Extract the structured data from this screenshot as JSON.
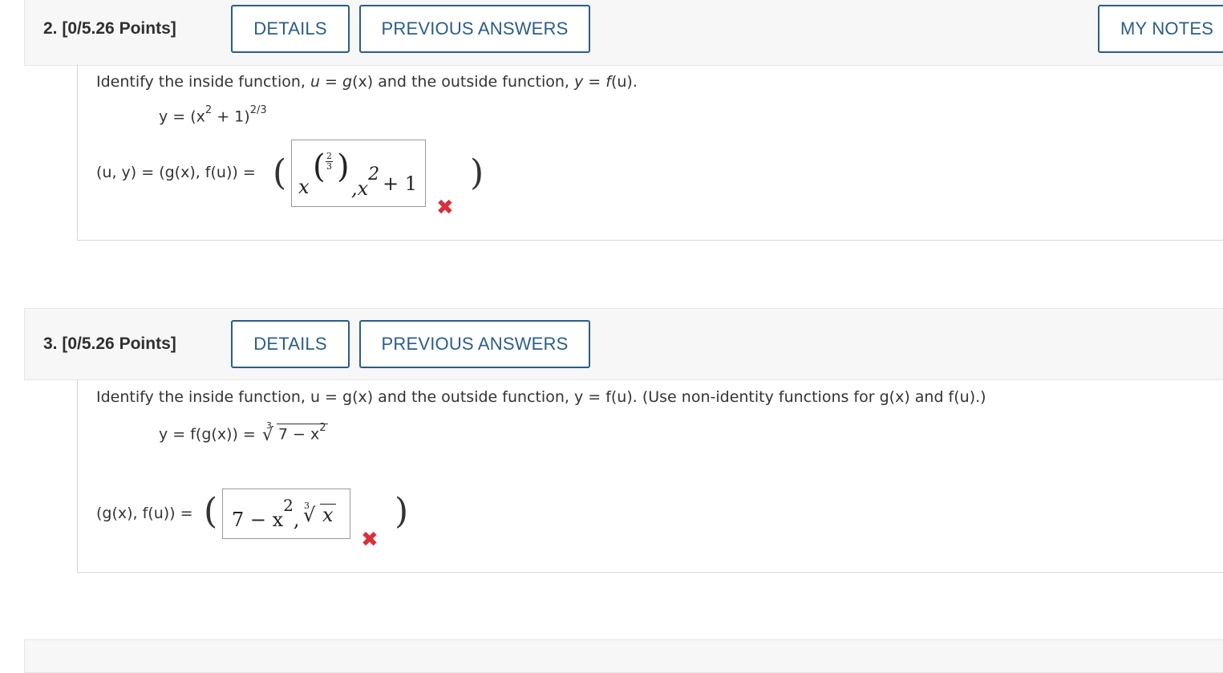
{
  "q2": {
    "number": "2.",
    "points": "[0/5.26 Points]",
    "details_label": "DETAILS",
    "prev_label": "PREVIOUS ANSWERS",
    "notes_label": "MY NOTES",
    "prompt_start": "Identify the inside function, ",
    "prompt_u": "u",
    "prompt_eq1": " = ",
    "prompt_gx": "g",
    "prompt_x": "(x)",
    "prompt_mid": " and the outside function, ",
    "prompt_y": "y",
    "prompt_eq2": " = ",
    "prompt_f": "f",
    "prompt_fu": "(u)",
    "prompt_end": ".",
    "equation_lhs": "y = (x",
    "equation_sq": "2",
    "equation_rest": " + 1)",
    "equation_exp": "2/3",
    "answer_label": "(u, y) = (g(x), f(u)) = ",
    "answer_x": "x",
    "answer_frac_num": "2",
    "answer_frac_den": "3",
    "answer_rest": ",x",
    "answer_sq": "2",
    "answer_plus": "+ 1",
    "status_icon": "close-icon",
    "status_color": "#d9303a"
  },
  "q3": {
    "number": "3.",
    "points": "[0/5.26 Points]",
    "details_label": "DETAILS",
    "prev_label": "PREVIOUS ANSWERS",
    "prompt": "Identify the inside function, u = g(x) and the outside function, y = f(u). (Use non-identity functions for g(x) and f(u).)",
    "equation_lhs": "y = f(g(x)) = ",
    "equation_root_index": "3",
    "equation_radicand": "7 − x",
    "equation_sq": "2",
    "answer_label": "(g(x), f(u)) = ",
    "answer_part1": "7 − x",
    "answer_sq": "2",
    "answer_root_index": "3",
    "answer_radicand": "x",
    "status_icon": "close-icon",
    "status_color": "#d9303a"
  },
  "theme": {
    "accent": "#2a5d8c",
    "header_bg": "#f7f7f7"
  }
}
